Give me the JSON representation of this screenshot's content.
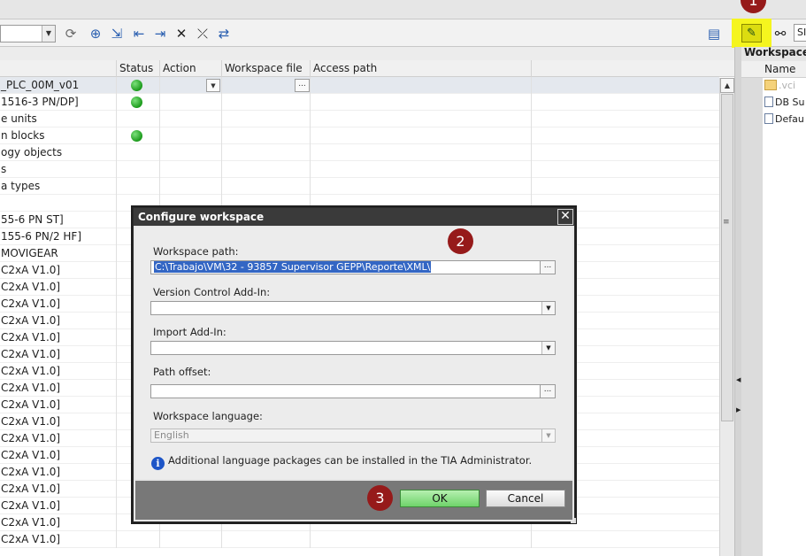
{
  "toolbar": {
    "combo_value": "",
    "edge_field": "SI"
  },
  "grid": {
    "columns": [
      "",
      "Status",
      "Action",
      "Workspace file",
      "Access path"
    ],
    "rows": [
      {
        "name": "_PLC_00M_v01",
        "status": "green",
        "selected": true
      },
      {
        "name": "1516-3 PN/DP]",
        "status": "green"
      },
      {
        "name": "e units",
        "status": ""
      },
      {
        "name": "n blocks",
        "status": "green"
      },
      {
        "name": "ogy objects",
        "status": ""
      },
      {
        "name": "s",
        "status": ""
      },
      {
        "name": "a types",
        "status": ""
      },
      {
        "name": "",
        "status": ""
      },
      {
        "name": " 55-6 PN ST]",
        "status": ""
      },
      {
        "name": " 155-6 PN/2 HF]",
        "status": ""
      },
      {
        "name": "MOVIGEAR",
        "status": ""
      },
      {
        "name": "C2xA V1.0]",
        "status": ""
      },
      {
        "name": "C2xA V1.0]",
        "status": ""
      },
      {
        "name": "C2xA V1.0]",
        "status": ""
      },
      {
        "name": "C2xA V1.0]",
        "status": ""
      },
      {
        "name": "C2xA V1.0]",
        "status": ""
      },
      {
        "name": "C2xA V1.0]",
        "status": ""
      },
      {
        "name": "C2xA V1.0]",
        "status": ""
      },
      {
        "name": "C2xA V1.0]",
        "status": ""
      },
      {
        "name": "C2xA V1.0]",
        "status": ""
      },
      {
        "name": "C2xA V1.0]",
        "status": ""
      },
      {
        "name": "C2xA V1.0]",
        "status": ""
      },
      {
        "name": "C2xA V1.0]",
        "status": ""
      },
      {
        "name": "C2xA V1.0]",
        "status": ""
      },
      {
        "name": "C2xA V1.0]",
        "status": ""
      },
      {
        "name": "C2xA V1.0]",
        "status": ""
      },
      {
        "name": "C2xA V1.0]",
        "status": ""
      },
      {
        "name": "C2xA V1.0]",
        "status": ""
      }
    ]
  },
  "workspace_panel": {
    "title": "Workspace",
    "column": "Name",
    "items": [
      {
        "name": ".vci",
        "icon": "folder-icon"
      },
      {
        "name": "DB Su",
        "icon": "document-icon"
      },
      {
        "name": "Defau",
        "icon": "document-icon"
      }
    ]
  },
  "markers": {
    "m1": "1",
    "m2": "2",
    "m3": "3"
  },
  "dialog": {
    "title": "Configure workspace",
    "workspace_path_label": "Workspace path:",
    "workspace_path_value": "C:\\Trabajo\\VM\\32 - 93857 Supervisor GEPP\\Reporte\\XML\\",
    "vcs_label": "Version Control Add-In:",
    "vcs_value": "",
    "import_label": "Import Add-In:",
    "import_value": "",
    "offset_label": "Path offset:",
    "offset_value": "",
    "language_label": "Workspace language:",
    "language_value": "English",
    "info_text": "Additional language packages can be installed in the TIA Administrator.",
    "ok_label": "OK",
    "cancel_label": "Cancel"
  },
  "colors": {
    "status_ok": "#1b9a1b",
    "highlight": "#f5f51e",
    "marker": "#961a1a",
    "ok_button": "#6fd36a"
  }
}
